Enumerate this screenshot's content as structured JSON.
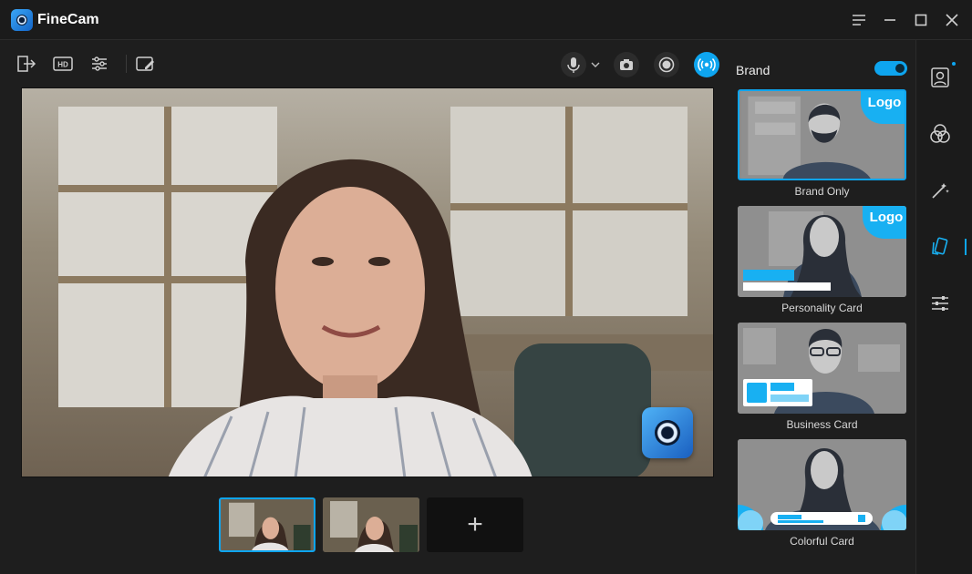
{
  "app": {
    "title": "FineCam"
  },
  "toolbar": {
    "tools": [
      "exit-icon",
      "hd-icon",
      "adjust-icon",
      "whiteboard-icon"
    ],
    "hd_label": "HD"
  },
  "brand": {
    "label": "Brand",
    "enabled": true,
    "cards": [
      {
        "label": "Brand Only",
        "badge": "Logo"
      },
      {
        "label": "Personality Card",
        "badge": "Logo"
      },
      {
        "label": "Business Card",
        "badge": ""
      },
      {
        "label": "Colorful Card",
        "badge": ""
      }
    ]
  },
  "thumbs": {
    "add_label": "+"
  },
  "colors": {
    "accent": "#0ea5ef",
    "bg": "#1e1e1e"
  }
}
